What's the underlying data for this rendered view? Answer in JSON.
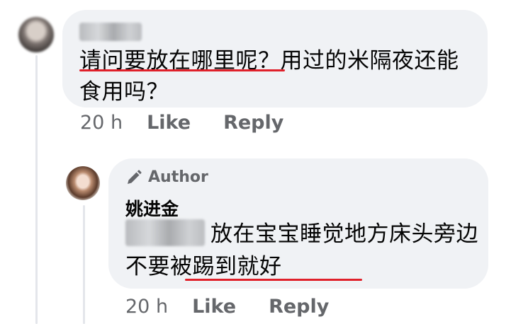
{
  "comments": [
    {
      "author": "",
      "text": "请问要放在哪里呢？用过的米隔夜还能食用吗？",
      "time": "20 h",
      "like_label": "Like",
      "reply_label": "Reply",
      "underline_color": "#e0202a"
    },
    {
      "badge": "Author",
      "author": "姚进金",
      "mention": "",
      "text": "放在宝宝睡觉地方床头旁边 不要被踢到就好",
      "time": "20 h",
      "like_label": "Like",
      "reply_label": "Reply",
      "underline_color": "#e0202a"
    }
  ],
  "colors": {
    "bubble": "#f0f2f5",
    "meta": "#65676b",
    "text": "#050505",
    "accent": "#e0202a"
  }
}
